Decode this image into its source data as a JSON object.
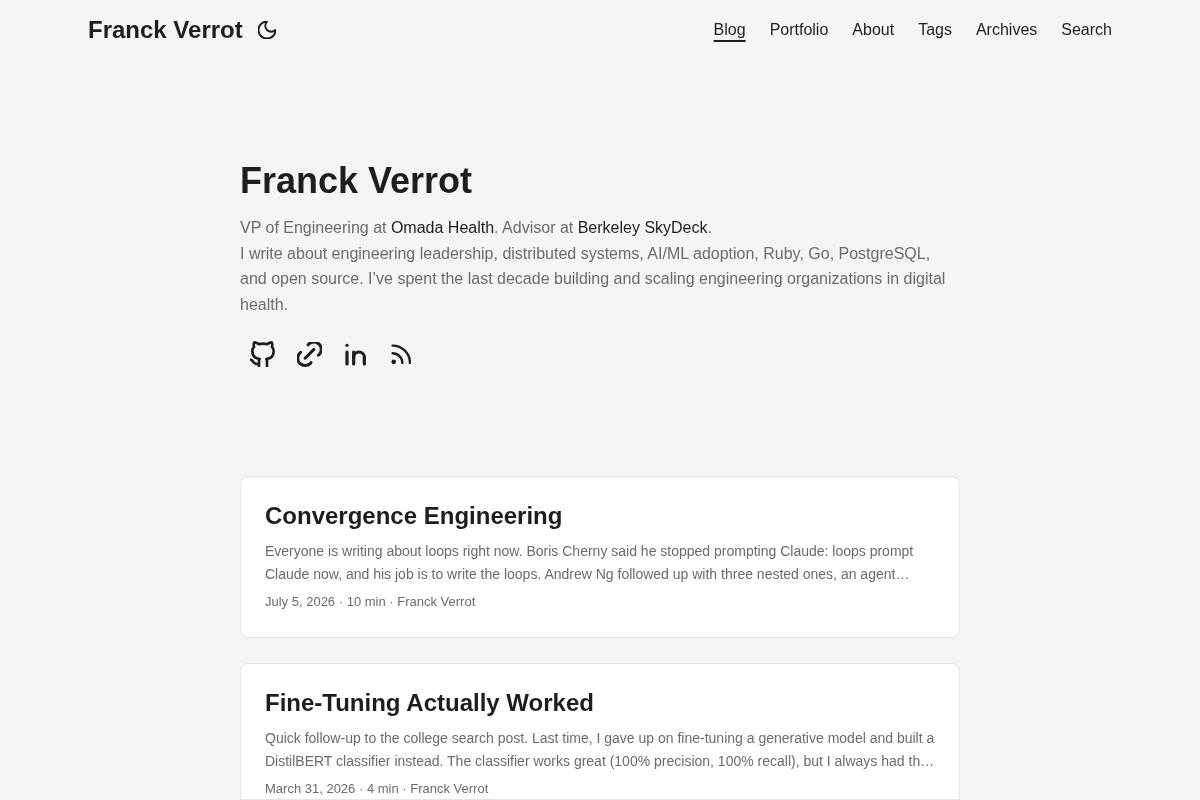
{
  "header": {
    "site_title": "Franck Verrot"
  },
  "nav": [
    {
      "label": "Blog",
      "selected": true
    },
    {
      "label": "Portfolio",
      "selected": false
    },
    {
      "label": "About",
      "selected": false
    },
    {
      "label": "Tags",
      "selected": false
    },
    {
      "label": "Archives",
      "selected": false
    },
    {
      "label": "Search",
      "selected": false
    }
  ],
  "profile": {
    "name": "Franck Verrot",
    "affiliation": [
      {
        "kind": "text",
        "text": "VP of Engineering at "
      },
      {
        "kind": "link",
        "text": "Omada Health"
      },
      {
        "kind": "text",
        "text": ". Advisor at "
      },
      {
        "kind": "link",
        "text": "Berkeley SkyDeck"
      },
      {
        "kind": "text",
        "text": "."
      }
    ],
    "bio": "I write about engineering leadership, distributed systems, AI/ML adoption, Ruby, Go, PostgreSQL, and open source. I’ve spent the last decade building and scaling engineering organizations in digital health."
  },
  "posts": [
    {
      "title": "Convergence Engineering",
      "excerpt": "Everyone is writing about loops right now. Boris Cherny said he stopped prompting Claude: loops prompt Claude now, and his job is to write the loops. Andrew Ng followed up with three nested ones, an agent…",
      "meta": "July 5, 2026 · 10 min · Franck Verrot"
    },
    {
      "title": "Fine-Tuning Actually Worked",
      "excerpt": "Quick follow-up to the college search post. Last time, I gave up on fine-tuning a generative model and built a DistilBERT classifier instead. The classifier works great (100% precision, 100% recall), but I always had th…",
      "meta": "March 31, 2026 · 4 min · Franck Verrot"
    }
  ]
}
